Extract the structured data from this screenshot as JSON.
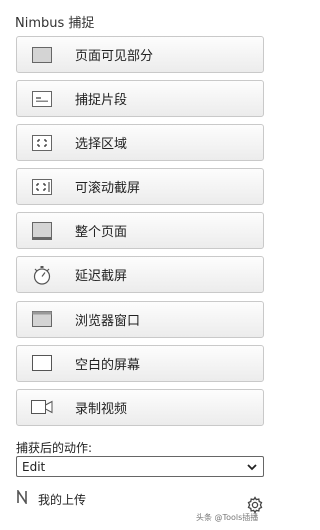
{
  "header": {
    "title": "Nimbus 捕捉"
  },
  "capture_buttons": [
    {
      "label": "页面可见部分",
      "icon": "visible-part-icon"
    },
    {
      "label": "捕捉片段",
      "icon": "fragment-icon"
    },
    {
      "label": "选择区域",
      "icon": "select-area-icon"
    },
    {
      "label": "可滚动截屏",
      "icon": "scrollable-icon"
    },
    {
      "label": "整个页面",
      "icon": "entire-page-icon"
    },
    {
      "label": "延迟截屏",
      "icon": "timer-icon"
    },
    {
      "label": "浏览器窗口",
      "icon": "browser-window-icon"
    },
    {
      "label": "空白的屏幕",
      "icon": "blank-screen-icon"
    },
    {
      "label": "录制视频",
      "icon": "video-camera-icon"
    }
  ],
  "after_capture": {
    "label": "捕获后的动作:",
    "selected": "Edit"
  },
  "footer": {
    "uploads_label": "我的上传",
    "watermark": "头条 @Tools插播",
    "settings_icon": "gear-icon"
  }
}
